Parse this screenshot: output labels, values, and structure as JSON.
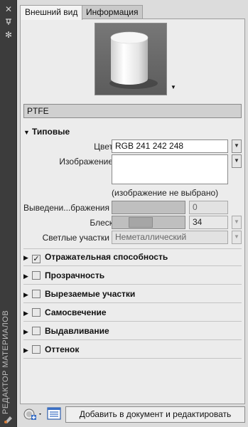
{
  "side_strip": {
    "title": "РЕДАКТОР МАТЕРИАЛОВ",
    "buttons": [
      "close-icon",
      "auto-hide-icon",
      "properties-icon"
    ]
  },
  "tabs": [
    {
      "label": "Внешний вид",
      "active": true
    },
    {
      "label": "Информация",
      "active": false
    }
  ],
  "material_name": "PTFE",
  "generic": {
    "header": "Типовые",
    "color_label": "Цвет",
    "color_value": "RGB 241 242 248",
    "image_label": "Изображение",
    "image_caption": "(изображение не выбрано)",
    "fade_label": "Выведени...бражения",
    "fade_value": "0",
    "glossiness_label": "Блеск",
    "glossiness_value": "34",
    "glossiness_fraction": 0.34,
    "highlights_label": "Светлые участки",
    "highlights_value": "Неметаллический"
  },
  "groups": [
    {
      "label": "Отражательная способность",
      "checked": true
    },
    {
      "label": "Прозрачность",
      "checked": false
    },
    {
      "label": "Вырезаемые участки",
      "checked": false
    },
    {
      "label": "Самосвечение",
      "checked": false
    },
    {
      "label": "Выдавливание",
      "checked": false
    },
    {
      "label": "Оттенок",
      "checked": false
    }
  ],
  "bottom": {
    "action_label": "Добавить в документ и редактировать"
  },
  "colors": {
    "panel_bg": "#ececec",
    "strip_bg": "#3c3c3c",
    "accent_blue": "#3a6fc4"
  }
}
